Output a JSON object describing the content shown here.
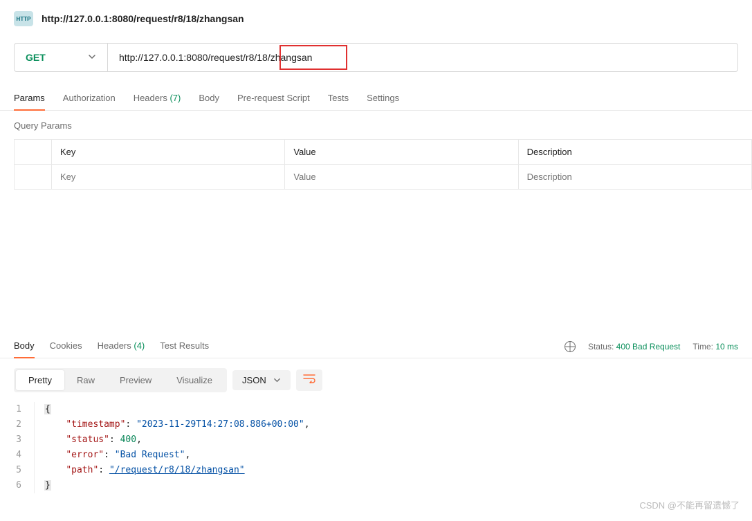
{
  "header": {
    "icon_label": "HTTP",
    "title": "http://127.0.0.1:8080/request/r8/18/zhangsan"
  },
  "request": {
    "method": "GET",
    "url": "http://127.0.0.1:8080/request/r8/18/zhangsan",
    "highlight_text": "18/zhangsan"
  },
  "tabs": {
    "params": "Params",
    "authorization": "Authorization",
    "headers": "Headers",
    "headers_count": "(7)",
    "body": "Body",
    "prerequest": "Pre-request Script",
    "tests": "Tests",
    "settings": "Settings"
  },
  "query_params": {
    "title": "Query Params",
    "columns": {
      "key": "Key",
      "value": "Value",
      "description": "Description"
    },
    "placeholders": {
      "key": "Key",
      "value": "Value",
      "description": "Description"
    }
  },
  "response_tabs": {
    "body": "Body",
    "cookies": "Cookies",
    "headers": "Headers",
    "headers_count": "(4)",
    "tests": "Test Results"
  },
  "response_meta": {
    "status_label": "Status:",
    "status_value": "400 Bad Request",
    "time_label": "Time:",
    "time_value": "10 ms"
  },
  "body_toolbar": {
    "pretty": "Pretty",
    "raw": "Raw",
    "preview": "Preview",
    "visualize": "Visualize",
    "format": "JSON"
  },
  "response_body": {
    "lines": [
      "1",
      "2",
      "3",
      "4",
      "5",
      "6"
    ],
    "timestamp_key": "\"timestamp\"",
    "timestamp_val": "\"2023-11-29T14:27:08.886+00:00\"",
    "status_key": "\"status\"",
    "status_val": "400",
    "error_key": "\"error\"",
    "error_val": "\"Bad Request\"",
    "path_key": "\"path\"",
    "path_val": "\"/request/r8/18/zhangsan\""
  },
  "watermark": "CSDN @不能再留遗憾了"
}
